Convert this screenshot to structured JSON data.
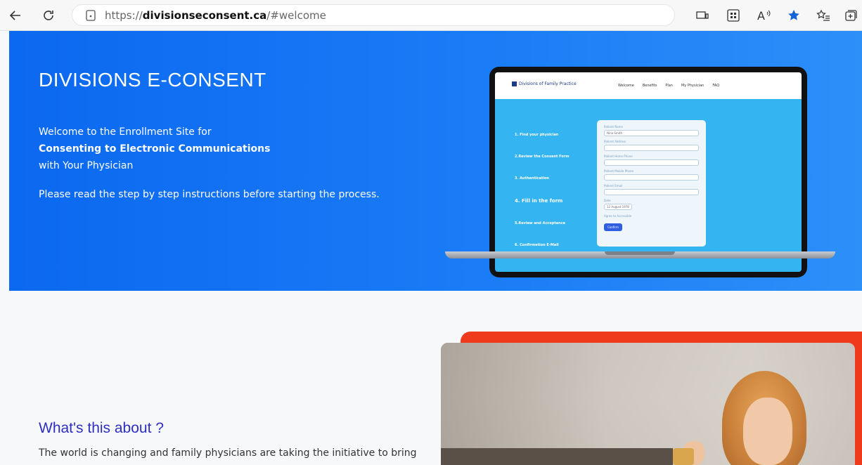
{
  "browser": {
    "url_prefix": "https://",
    "url_domain": "divisionseconsent.ca",
    "url_path": "/#welcome"
  },
  "hero": {
    "title": "DIVISIONS E-CONSENT",
    "line1": "Welcome to the Enrollment Site for",
    "line2": "Consenting to Electronic Communications",
    "line3": "with Your Physician",
    "line4": "Please read the step by step instructions before starting the process."
  },
  "mockup": {
    "logo": "Divisions of Family Practice",
    "nav": [
      "Welcome",
      "Benefits",
      "Plan",
      "My Physician",
      "FAQ"
    ],
    "steps": [
      "1. Find your physician",
      "2.Review the Consent Form",
      "3. Authentication",
      "4. Fill in the form",
      "5.Review and Acceptance",
      "6. Confirmation E-Mail"
    ],
    "fields": [
      "Patient Name",
      "Patient Address",
      "Patient Home Phone",
      "Patient Mobile Phone",
      "Patient Email",
      "Date"
    ],
    "name_value": "Nina Smith",
    "date_value": "12 August 1978",
    "checkbox": "Agree to Accessible",
    "button": "Confirm"
  },
  "section2": {
    "title": "What's this about ?",
    "body": "The world is changing and family physicians are taking the initiative to bring"
  }
}
